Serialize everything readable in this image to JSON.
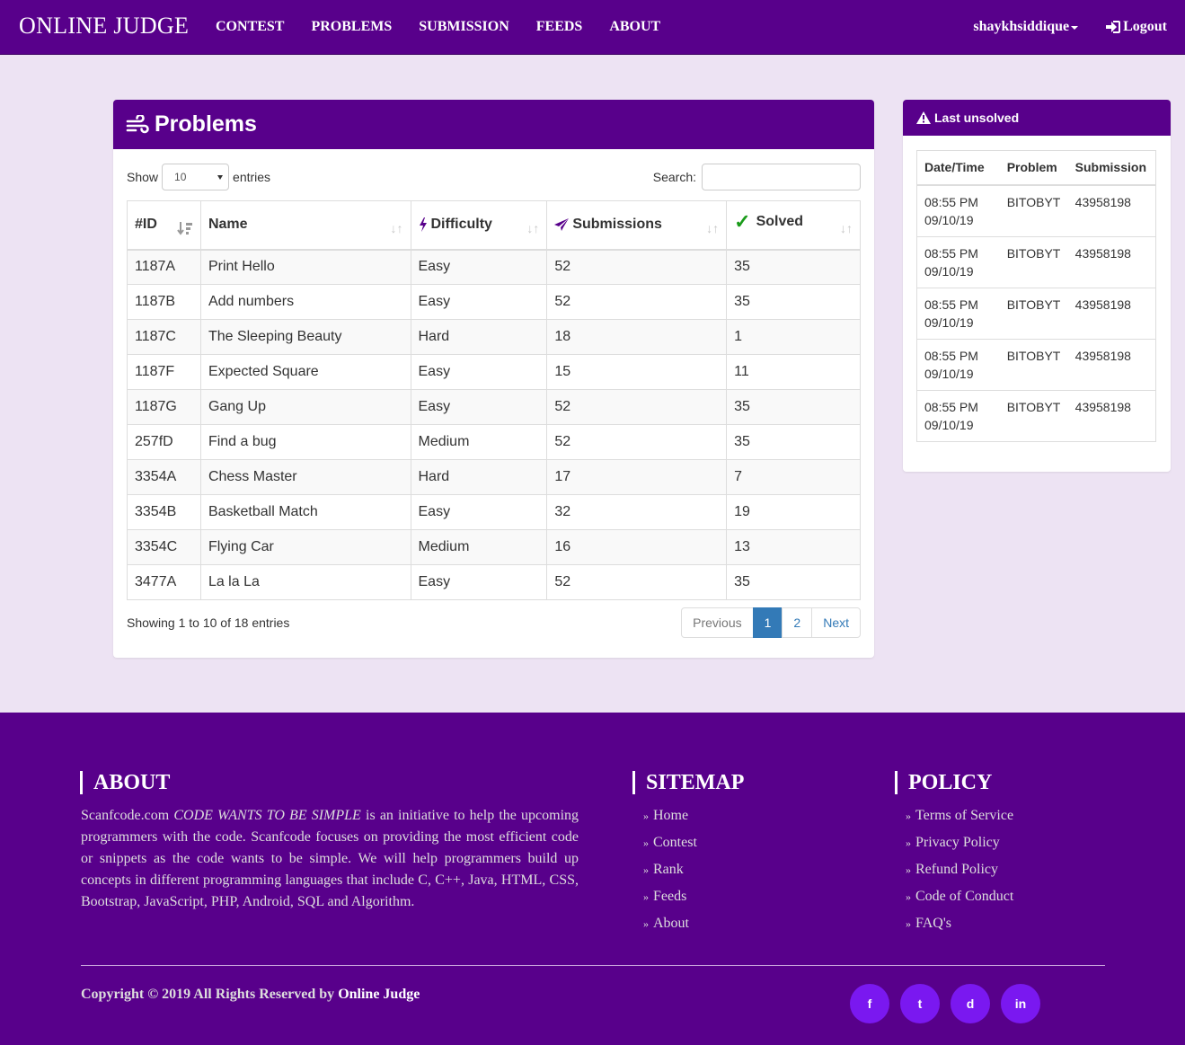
{
  "nav": {
    "brand": "ONLINE JUDGE",
    "links": [
      "CONTEST",
      "PROBLEMS",
      "SUBMISSION",
      "FEEDS",
      "ABOUT"
    ],
    "user": "shaykhsiddique",
    "logout": "Logout"
  },
  "problems": {
    "title": "Problems",
    "show_label": "Show",
    "entries_label": "entries",
    "page_size": "10",
    "search_label": "Search:",
    "columns": [
      "#ID",
      "Name",
      "Difficulty",
      "Submissions",
      "Solved"
    ],
    "rows": [
      {
        "id": "1187A",
        "name": "Print Hello",
        "difficulty": "Easy",
        "submissions": "52",
        "solved": "35"
      },
      {
        "id": "1187B",
        "name": "Add numbers",
        "difficulty": "Easy",
        "submissions": "52",
        "solved": "35"
      },
      {
        "id": "1187C",
        "name": "The Sleeping Beauty",
        "difficulty": "Hard",
        "submissions": "18",
        "solved": "1"
      },
      {
        "id": "1187F",
        "name": "Expected Square",
        "difficulty": "Easy",
        "submissions": "15",
        "solved": "11"
      },
      {
        "id": "1187G",
        "name": "Gang Up",
        "difficulty": "Easy",
        "submissions": "52",
        "solved": "35"
      },
      {
        "id": "257fD",
        "name": "Find a bug",
        "difficulty": "Medium",
        "submissions": "52",
        "solved": "35"
      },
      {
        "id": "3354A",
        "name": "Chess Master",
        "difficulty": "Hard",
        "submissions": "17",
        "solved": "7"
      },
      {
        "id": "3354B",
        "name": "Basketball Match",
        "difficulty": "Easy",
        "submissions": "32",
        "solved": "19"
      },
      {
        "id": "3354C",
        "name": "Flying Car",
        "difficulty": "Medium",
        "submissions": "16",
        "solved": "13"
      },
      {
        "id": "3477A",
        "name": "La la La",
        "difficulty": "Easy",
        "submissions": "52",
        "solved": "35"
      }
    ],
    "info": "Showing 1 to 10 of 18 entries",
    "pager": {
      "previous": "Previous",
      "pages": [
        "1",
        "2"
      ],
      "next": "Next"
    }
  },
  "last_unsolved": {
    "title": "Last unsolved",
    "columns": [
      "Date/Time",
      "Problem",
      "Submission"
    ],
    "rows": [
      {
        "time": "08:55 PM",
        "date": "09/10/19",
        "problem": "BITOBYT",
        "submission": "43958198"
      },
      {
        "time": "08:55 PM",
        "date": "09/10/19",
        "problem": "BITOBYT",
        "submission": "43958198"
      },
      {
        "time": "08:55 PM",
        "date": "09/10/19",
        "problem": "BITOBYT",
        "submission": "43958198"
      },
      {
        "time": "08:55 PM",
        "date": "09/10/19",
        "problem": "BITOBYT",
        "submission": "43958198"
      },
      {
        "time": "08:55 PM",
        "date": "09/10/19",
        "problem": "BITOBYT",
        "submission": "43958198"
      }
    ]
  },
  "footer": {
    "about_title": "ABOUT",
    "about_site": "Scanfcode.com",
    "about_motto": "CODE WANTS TO BE SIMPLE",
    "about_text": "is an initiative to help the upcoming programmers with the code. Scanfcode focuses on providing the most efficient code or snippets as the code wants to be simple. We will help programmers build up concepts in different programming languages that include C, C++, Java, HTML, CSS, Bootstrap, JavaScript, PHP, Android, SQL and Algorithm.",
    "sitemap_title": "SITEMAP",
    "sitemap": [
      "Home",
      "Contest",
      "Rank",
      "Feeds",
      "About"
    ],
    "policy_title": "POLICY",
    "policy": [
      "Terms of Service",
      "Privacy Policy",
      "Refund Policy",
      "Code of Conduct",
      "FAQ's"
    ],
    "copyright": "Copyright © 2019 All Rights Reserved by",
    "copyright_owner": "Online Judge",
    "socials": [
      "facebook-icon",
      "twitter-icon",
      "dribbble-icon",
      "linkedin-icon"
    ],
    "socials_text": [
      "f",
      "t",
      "d",
      "in"
    ]
  },
  "colors": {
    "brand": "#58008b",
    "page_bg": "#ede3f3",
    "social": "#7a18f0",
    "pager_active": "#337ab7",
    "solved_check": "#1a9b1a"
  }
}
